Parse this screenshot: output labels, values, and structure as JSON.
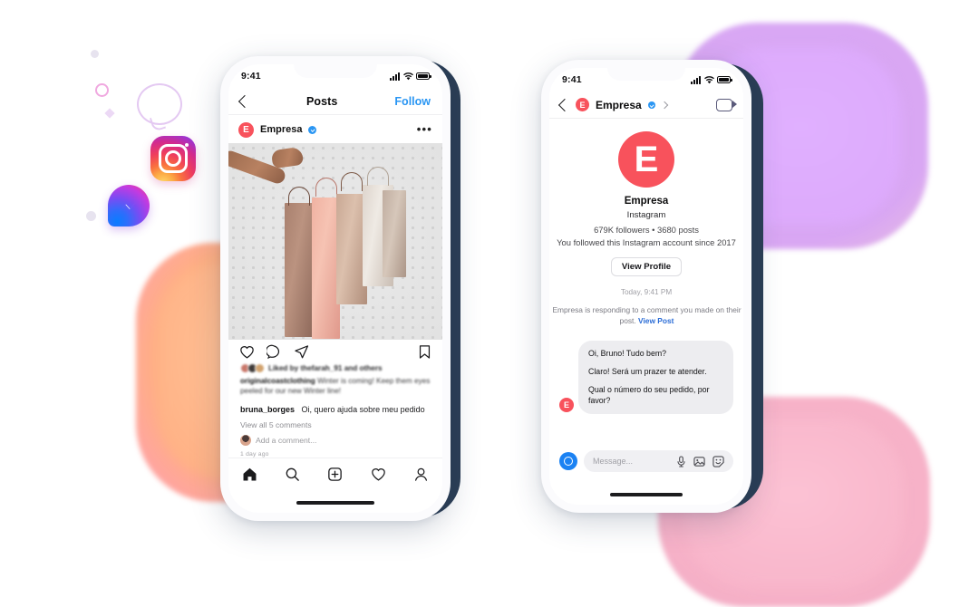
{
  "scene": {
    "title": "Instagram post and Messenger conversation on two phones",
    "brand_logos": [
      "instagram-logo",
      "messenger-logo"
    ],
    "colors": {
      "accent_blue": "#2a96f3",
      "brand_red": "#f8525c",
      "messenger_blue": "#1b82f3",
      "shadow_navy": "#2b3e55",
      "blob_purple": "#d8a8f5",
      "blob_orange": "#ffb785",
      "blob_pink": "#f8b6cb"
    }
  },
  "phone_instagram": {
    "status_bar": {
      "time": "9:41",
      "signal_icon": "cellular-bars-icon",
      "wifi_icon": "wifi-icon",
      "battery_icon": "battery-icon"
    },
    "nav": {
      "back_icon": "chevron-left-icon",
      "title": "Posts",
      "follow_label": "Follow"
    },
    "post_header": {
      "avatar_letter": "E",
      "username": "Empresa",
      "verified_icon": "verified-badge-icon",
      "more_icon": "more-options-icon",
      "more_glyph": "•••"
    },
    "photo": {
      "alt_name": "shopping-bags-photo",
      "description": "Hand holding four shopping bags"
    },
    "actions": {
      "like_icon": "heart-icon",
      "comment_icon": "comment-icon",
      "share_icon": "share-icon",
      "save_icon": "bookmark-icon"
    },
    "meta": {
      "liked_by": "Liked by thefarah_91 and others",
      "caption_user": "originalcoastclothing",
      "caption_text": "Winter is coming! Keep them eyes peeled for our new Winter line!",
      "comment_user": "bruna_borges",
      "comment_text": "Oi, quero ajuda sobre meu pedido",
      "view_all": "View all 5 comments",
      "add_comment_placeholder": "Add a comment...",
      "time_ago": "1 day ago"
    },
    "tabbar": {
      "items": [
        {
          "name": "home-icon",
          "label": "Home"
        },
        {
          "name": "search-icon",
          "label": "Search"
        },
        {
          "name": "add-post-icon",
          "label": "New post"
        },
        {
          "name": "activity-heart-icon",
          "label": "Activity"
        },
        {
          "name": "profile-icon",
          "label": "Profile"
        }
      ]
    }
  },
  "phone_messenger": {
    "status_bar": {
      "time": "9:41",
      "signal_icon": "cellular-bars-icon",
      "wifi_icon": "wifi-icon",
      "battery_icon": "battery-icon"
    },
    "nav": {
      "back_icon": "chevron-left-icon",
      "avatar_letter": "E",
      "name": "Empresa",
      "verified_icon": "verified-badge-icon",
      "chevron_icon": "chevron-right-icon",
      "video_call_icon": "video-call-icon"
    },
    "profile": {
      "avatar_letter": "E",
      "name": "Empresa",
      "platform": "Instagram",
      "stats": "679K followers • 3680 posts",
      "since": "You followed this Instagram account since 2017",
      "view_profile_label": "View Profile"
    },
    "thread": {
      "day_stamp": "Today, 9:41 PM",
      "system_message": "Empresa is responding to a comment you made on their post.",
      "system_link": "View Post",
      "sender_avatar_letter": "E",
      "messages": [
        "Oi, Bruno! Tudo bem?",
        "Claro! Será um prazer te atender.",
        "Qual o número do seu pedido, por favor?"
      ]
    },
    "input_bar": {
      "camera_icon": "camera-icon",
      "placeholder": "Message...",
      "mic_icon": "microphone-icon",
      "gallery_icon": "image-icon",
      "sticker_icon": "sticker-icon"
    }
  }
}
